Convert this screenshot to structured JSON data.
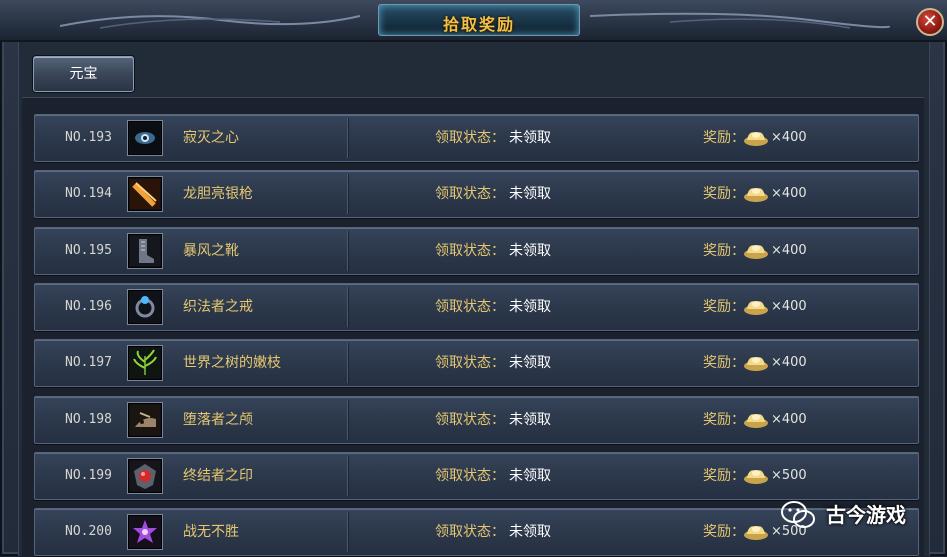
{
  "window": {
    "title": "拾取奖励",
    "close_label": "✕"
  },
  "tabs": [
    {
      "label": "元宝"
    }
  ],
  "colors": {
    "gold_text": "#e5c770",
    "title_gold": "#f1c24a",
    "white_text": "#ffffff"
  },
  "rows": [
    {
      "no": "NO.193",
      "name": "寂灭之心",
      "icon": "eye-gem-icon",
      "status_label": "领取状态：",
      "status": "未领取",
      "reward_label": "奖励：",
      "qty": "×400"
    },
    {
      "no": "NO.194",
      "name": "龙胆亮银枪",
      "icon": "spear-icon",
      "status_label": "领取状态：",
      "status": "未领取",
      "reward_label": "奖励：",
      "qty": "×400"
    },
    {
      "no": "NO.195",
      "name": "暴风之靴",
      "icon": "boots-icon",
      "status_label": "领取状态：",
      "status": "未领取",
      "reward_label": "奖励：",
      "qty": "×400"
    },
    {
      "no": "NO.196",
      "name": "织法者之戒",
      "icon": "ring-icon",
      "status_label": "领取状态：",
      "status": "未领取",
      "reward_label": "奖励：",
      "qty": "×400"
    },
    {
      "no": "NO.197",
      "name": "世界之树的嫩枝",
      "icon": "sprout-icon",
      "status_label": "领取状态：",
      "status": "未领取",
      "reward_label": "奖励：",
      "qty": "×400"
    },
    {
      "no": "NO.198",
      "name": "堕落者之颅",
      "icon": "skull-icon",
      "status_label": "领取状态：",
      "status": "未领取",
      "reward_label": "奖励：",
      "qty": "×400"
    },
    {
      "no": "NO.199",
      "name": "终结者之印",
      "icon": "red-seal-icon",
      "status_label": "领取状态：",
      "status": "未领取",
      "reward_label": "奖励：",
      "qty": "×500"
    },
    {
      "no": "NO.200",
      "name": "战无不胜",
      "icon": "purple-emblem-icon",
      "status_label": "领取状态：",
      "status": "未领取",
      "reward_label": "奖励：",
      "qty": "×500"
    }
  ],
  "reward_icon": "gold-ingot-icon",
  "watermark": {
    "icon": "wechat-icon",
    "text": "古今游戏"
  }
}
